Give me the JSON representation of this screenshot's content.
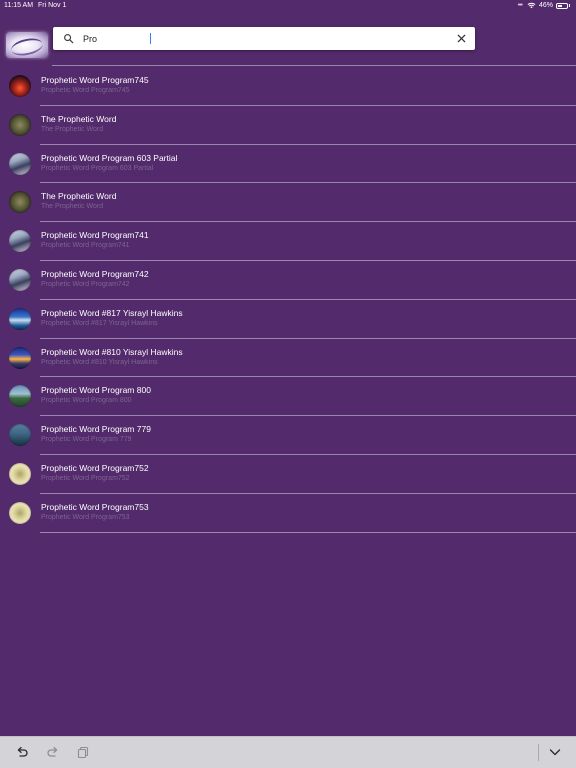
{
  "status_bar": {
    "time": "11:15 AM",
    "date": "Fri Nov 1",
    "battery": "46%",
    "battery_level": 0.46
  },
  "search": {
    "value": "Pro",
    "placeholder": ""
  },
  "icons": {
    "search": "search-icon",
    "clear": "close-icon",
    "undo": "undo-icon",
    "redo": "redo-icon",
    "paste": "clipboard-icon",
    "dismiss_keyboard": "chevron-down-icon"
  },
  "results": [
    {
      "title": "Prophetic Word Program745",
      "subtitle": "Prophetic Word Program745",
      "thumb": "sunset"
    },
    {
      "title": "The Prophetic Word",
      "subtitle": "The Prophetic Word",
      "thumb": "seal"
    },
    {
      "title": "Prophetic Word Program 603 Partial",
      "subtitle": "Prophetic Word Program 603 Partial",
      "thumb": "person"
    },
    {
      "title": "The Prophetic Word",
      "subtitle": "The Prophetic Word",
      "thumb": "seal"
    },
    {
      "title": "Prophetic Word Program741",
      "subtitle": "Prophetic Word Program741",
      "thumb": "person"
    },
    {
      "title": "Prophetic Word Program742",
      "subtitle": "Prophetic Word Program742",
      "thumb": "person"
    },
    {
      "title": "Prophetic Word #817 Yisrayl Hawkins",
      "subtitle": "Prophetic Word #817 Yisrayl Hawkins",
      "thumb": "lake"
    },
    {
      "title": "Prophetic Word #810 Yisrayl Hawkins",
      "subtitle": "Prophetic Word #810 Yisrayl Hawkins",
      "thumb": "dusk"
    },
    {
      "title": "Prophetic Word Program 800",
      "subtitle": "Prophetic Word Program 800",
      "thumb": "river"
    },
    {
      "title": "Prophetic Word Program 779",
      "subtitle": "Prophetic Word Program 779",
      "thumb": "sea"
    },
    {
      "title": "Prophetic Word Program752",
      "subtitle": "Prophetic Word Program752",
      "thumb": "scroll"
    },
    {
      "title": "Prophetic Word Program753",
      "subtitle": "Prophetic Word Program753",
      "thumb": "scroll"
    }
  ],
  "colors": {
    "background": "#532a6b",
    "subtitle": "#7c6590",
    "divider": "#9a86ad",
    "keyboard_bar": "#d4d4d8"
  }
}
